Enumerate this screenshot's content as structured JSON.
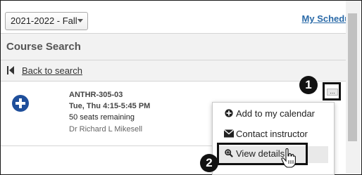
{
  "header": {
    "term_select_value": "2021-2022 - Fall",
    "my_schedule_link": "My Schedule"
  },
  "course_search": {
    "title": "Course Search",
    "back_link": "Back to search"
  },
  "result": {
    "course_code": "ANTHR-305-03",
    "meeting_time": "Tue, Thu 4:15-5:45 PM",
    "seats": "50 seats remaining",
    "instructor": "Dr Richard L Mikesell"
  },
  "more_button_label": "...",
  "menu": {
    "items": [
      {
        "label": "Add to my calendar",
        "icon": "plus-circle-icon"
      },
      {
        "label": "Contact instructor",
        "icon": "envelope-icon"
      },
      {
        "label": "View details",
        "icon": "magnifier-icon"
      }
    ]
  },
  "callouts": [
    "1",
    "2"
  ],
  "colors": {
    "link": "#2a6aa8",
    "add_button": "#1f4f9b",
    "callout": "#111111"
  }
}
